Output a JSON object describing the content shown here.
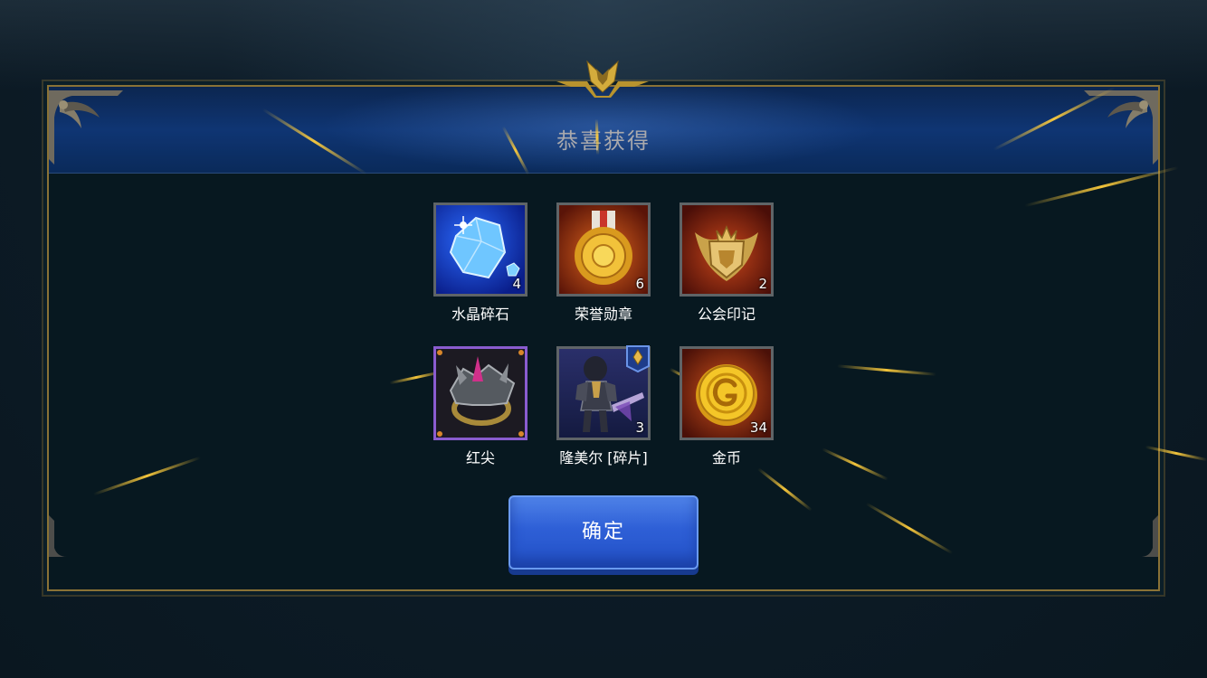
{
  "dialog": {
    "title": "恭喜获得",
    "confirm_label": "确定"
  },
  "rewards": [
    {
      "name": "水晶碎石",
      "count": "4",
      "icon": "crystal-icon",
      "frame": "gray"
    },
    {
      "name": "荣誉勋章",
      "count": "6",
      "icon": "medal-icon",
      "frame": "gray"
    },
    {
      "name": "公会印记",
      "count": "2",
      "icon": "guild-badge-icon",
      "frame": "gray"
    },
    {
      "name": "红尖",
      "count": "",
      "icon": "spiked-ring-icon",
      "frame": "purple"
    },
    {
      "name": "隆美尔 [碎片]",
      "count": "3",
      "icon": "hero-knight-icon",
      "frame": "gray"
    },
    {
      "name": "金币",
      "count": "34",
      "icon": "gold-coin-icon",
      "frame": "gray"
    }
  ],
  "colors": {
    "frame_gold": "#8a7236",
    "header_blue": "#0f3573",
    "button_blue": "#2e5fd6",
    "item_frame_purple": "#8a5ccf"
  }
}
